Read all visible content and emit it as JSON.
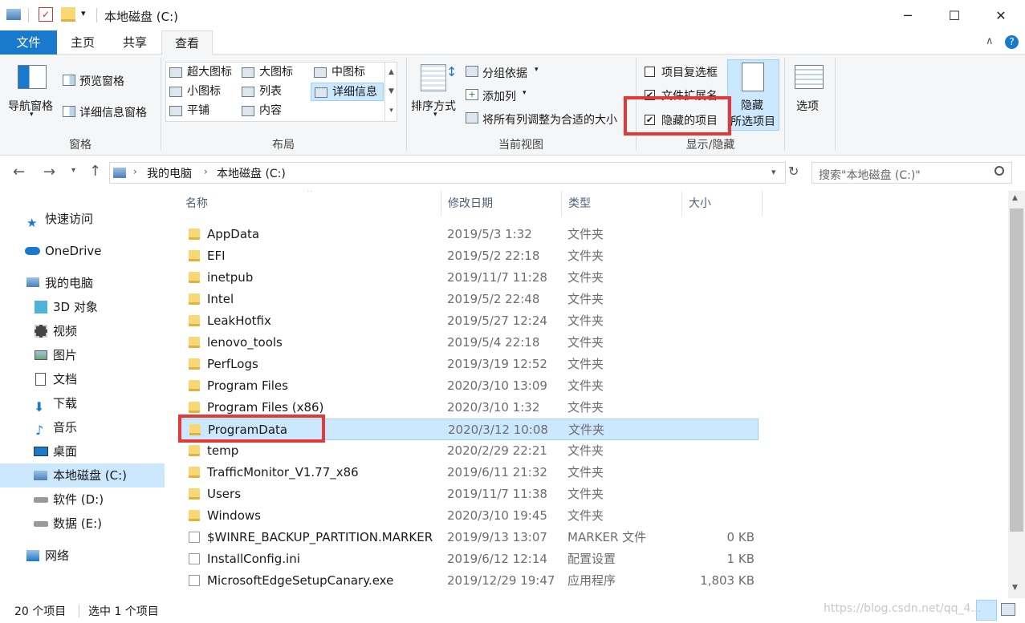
{
  "window": {
    "title": "本地磁盘 (C:)"
  },
  "tabs": {
    "file": "文件",
    "home": "主页",
    "share": "共享",
    "view": "查看"
  },
  "ribbon": {
    "pane": {
      "nav_pane": "导航窗格",
      "preview_pane": "预览窗格",
      "details_pane": "详细信息窗格",
      "label": "窗格"
    },
    "layout": {
      "items": [
        "超大图标",
        "大图标",
        "中图标",
        "小图标",
        "列表",
        "详细信息",
        "平铺",
        "内容"
      ],
      "label": "布局"
    },
    "current_view": {
      "sort_by": "排序方式",
      "group_by": "分组依据",
      "add_column": "添加列",
      "fit_columns": "将所有列调整为合适的大小",
      "label": "当前视图"
    },
    "show_hide": {
      "item_checkboxes": "项目复选框",
      "file_extensions": "文件扩展名",
      "hidden_items": "隐藏的项目",
      "hide_selected_line1": "隐藏",
      "hide_selected_line2": "所选项目",
      "label": "显示/隐藏",
      "check_mark": "✔"
    },
    "options": "选项"
  },
  "address": {
    "this_pc": "我的电脑",
    "drive": "本地磁盘 (C:)",
    "search_placeholder": "搜索\"本地磁盘 (C:)\""
  },
  "nav": {
    "quick_access": "快速访问",
    "onedrive": "OneDrive",
    "this_pc": "我的电脑",
    "objects3d": "3D 对象",
    "videos": "视频",
    "pictures": "图片",
    "documents": "文档",
    "downloads": "下载",
    "music": "音乐",
    "desktop": "桌面",
    "drive_c": "本地磁盘 (C:)",
    "drive_d": "软件 (D:)",
    "drive_e": "数据 (E:)",
    "network": "网络"
  },
  "columns": {
    "name": "名称",
    "date": "修改日期",
    "type": "类型",
    "size": "大小"
  },
  "files": [
    {
      "name": "AppData",
      "date": "2019/5/3 1:32",
      "type": "文件夹",
      "size": "",
      "kind": "folder"
    },
    {
      "name": "EFI",
      "date": "2019/5/2 22:18",
      "type": "文件夹",
      "size": "",
      "kind": "folder"
    },
    {
      "name": "inetpub",
      "date": "2019/11/7 11:28",
      "type": "文件夹",
      "size": "",
      "kind": "folder"
    },
    {
      "name": "Intel",
      "date": "2019/5/2 22:48",
      "type": "文件夹",
      "size": "",
      "kind": "folder"
    },
    {
      "name": "LeakHotfix",
      "date": "2019/5/27 12:24",
      "type": "文件夹",
      "size": "",
      "kind": "folder"
    },
    {
      "name": "lenovo_tools",
      "date": "2019/5/4 22:18",
      "type": "文件夹",
      "size": "",
      "kind": "folder"
    },
    {
      "name": "PerfLogs",
      "date": "2019/3/19 12:52",
      "type": "文件夹",
      "size": "",
      "kind": "folder"
    },
    {
      "name": "Program Files",
      "date": "2020/3/10 13:09",
      "type": "文件夹",
      "size": "",
      "kind": "folder"
    },
    {
      "name": "Program Files (x86)",
      "date": "2020/3/10 1:32",
      "type": "文件夹",
      "size": "",
      "kind": "folder"
    },
    {
      "name": "ProgramData",
      "date": "2020/3/12 10:08",
      "type": "文件夹",
      "size": "",
      "kind": "folder",
      "selected": true
    },
    {
      "name": "temp",
      "date": "2020/2/29 22:21",
      "type": "文件夹",
      "size": "",
      "kind": "folder"
    },
    {
      "name": "TrafficMonitor_V1.77_x86",
      "date": "2019/6/11 21:32",
      "type": "文件夹",
      "size": "",
      "kind": "folder"
    },
    {
      "name": "Users",
      "date": "2019/11/7 11:38",
      "type": "文件夹",
      "size": "",
      "kind": "folder"
    },
    {
      "name": "Windows",
      "date": "2020/3/10 19:45",
      "type": "文件夹",
      "size": "",
      "kind": "folder"
    },
    {
      "name": "$WINRE_BACKUP_PARTITION.MARKER",
      "date": "2019/9/13 13:07",
      "type": "MARKER 文件",
      "size": "0 KB",
      "kind": "file"
    },
    {
      "name": "InstallConfig.ini",
      "date": "2019/6/12 12:14",
      "type": "配置设置",
      "size": "1 KB",
      "kind": "file"
    },
    {
      "name": "MicrosoftEdgeSetupCanary.exe",
      "date": "2019/12/29 19:47",
      "type": "应用程序",
      "size": "1,803 KB",
      "kind": "file"
    }
  ],
  "status": {
    "count": "20 个项目",
    "selected": "选中 1 个项目"
  },
  "watermark": "https://blog.csdn.net/qq_4..."
}
